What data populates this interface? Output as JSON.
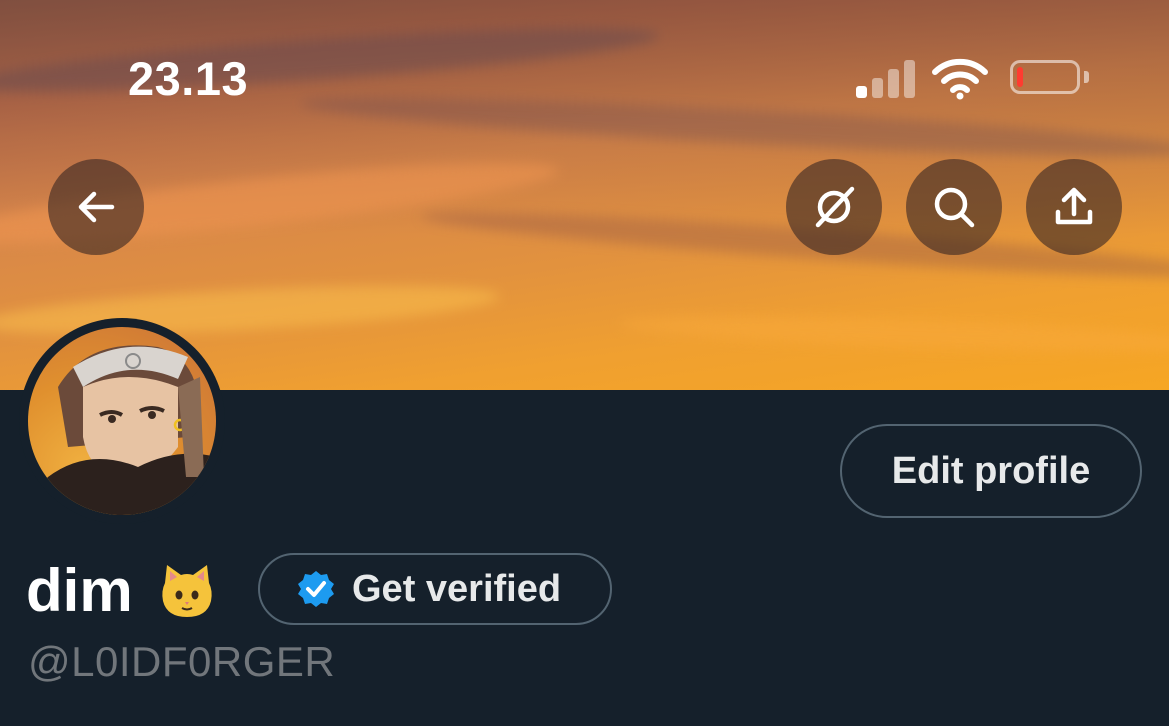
{
  "status_bar": {
    "time": "23.13",
    "signal_icon": "cellular-signal-icon",
    "wifi_icon": "wifi-icon",
    "battery_icon": "battery-low-icon",
    "battery_level": 0.1,
    "battery_color": "#ff3b30"
  },
  "header": {
    "back_icon": "arrow-left-icon",
    "grok_icon": "grok-icon",
    "search_icon": "search-icon",
    "share_icon": "share-upload-icon"
  },
  "profile": {
    "display_name": "dim",
    "name_emoji_icon": "cat-face-icon",
    "handle": "@L0IDF0RGER",
    "edit_label": "Edit profile",
    "verify_label": "Get verified",
    "verify_icon": "verified-badge-icon"
  },
  "theme": {
    "background": "#15202b",
    "border": "#536471",
    "muted_text": "#71767b",
    "accent_blue": "#1d9bf0"
  }
}
